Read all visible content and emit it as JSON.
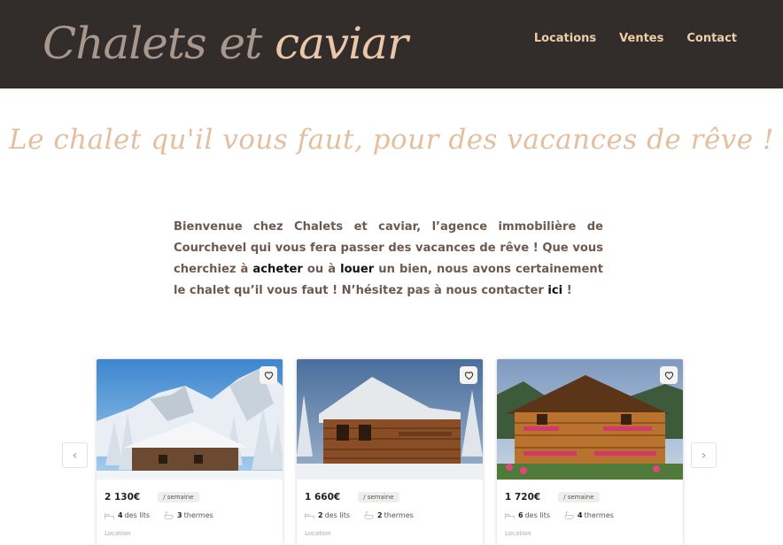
{
  "header": {
    "logo_part1": "Chalets et",
    "logo_part2": "caviar",
    "nav": [
      "Locations",
      "Ventes",
      "Contact"
    ]
  },
  "slogan": "Le chalet qu'il vous faut, pour des vacances de rêve !",
  "intro": {
    "t1": "Bienvenue chez Chalets et caviar, l’agence immobilière de Courchevel qui vous fera passer des vacances de rêve ! Que vous cherchiez à ",
    "k1": "acheter",
    "t2": " ou à ",
    "k2": "louer",
    "t3": " un bien, nous avons certainement le chalet qu’il vous faut ! N’hésitez pas à nous contacter ",
    "k3": "ici",
    "t4": " !"
  },
  "listings": [
    {
      "price": "2 130€",
      "unit": "/ semaine",
      "beds": "4",
      "beds_label": "des lits",
      "baths": "3",
      "baths_label": "thermes",
      "more": "Location"
    },
    {
      "price": "1 660€",
      "unit": "/ semaine",
      "beds": "2",
      "beds_label": "des lits",
      "baths": "2",
      "baths_label": "thermes",
      "more": "Location"
    },
    {
      "price": "1 720€",
      "unit": "/ semaine",
      "beds": "6",
      "beds_label": "des lits",
      "baths": "4",
      "baths_label": "thermes",
      "more": "Location"
    }
  ],
  "carousel": {
    "prev": "‹",
    "next": "›"
  },
  "colors": {
    "header_bg": "#322c2b",
    "accent": "#e9c7a8",
    "text": "#6c5a52"
  }
}
